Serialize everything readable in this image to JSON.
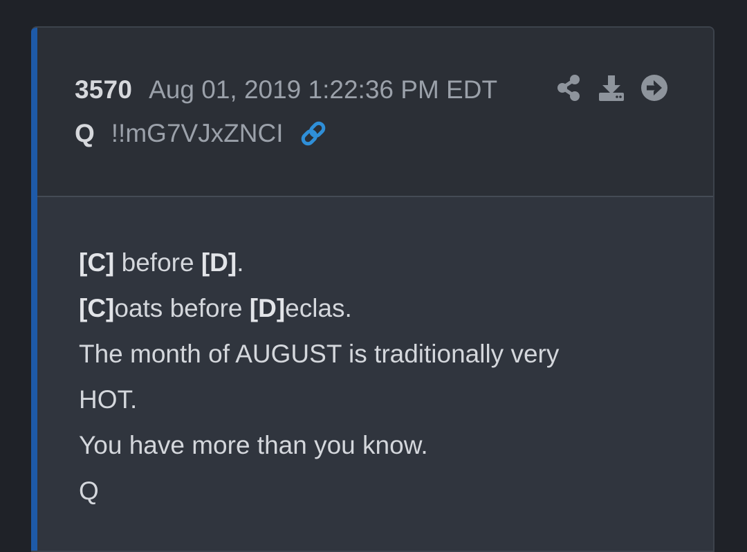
{
  "post": {
    "number": "3570",
    "date": "Aug 01, 2019 1:22:36 PM EDT",
    "author": "Q",
    "tripcode": "!!mG7VJxZNCI"
  },
  "actions": [
    {
      "name": "share",
      "icon": "share-icon"
    },
    {
      "name": "download",
      "icon": "download-icon"
    },
    {
      "name": "next",
      "icon": "arrow-right-circle-icon"
    }
  ],
  "body": {
    "line1": {
      "a": "[C]",
      "b": " before ",
      "c": "[D]",
      "d": "."
    },
    "line2": {
      "a": "[C]",
      "b": "oats before ",
      "c": "[D]",
      "d": "eclas."
    },
    "line3": "The month of AUGUST is traditionally very",
    "line4": "HOT.",
    "line5": "You have more than you know.",
    "line6": "Q"
  },
  "colors": {
    "background": "#1f2228",
    "card": "#2b2f36",
    "body": "#30353e",
    "accent": "#1e5aa8",
    "link": "#2f8fd8",
    "icon": "#8e949c"
  }
}
